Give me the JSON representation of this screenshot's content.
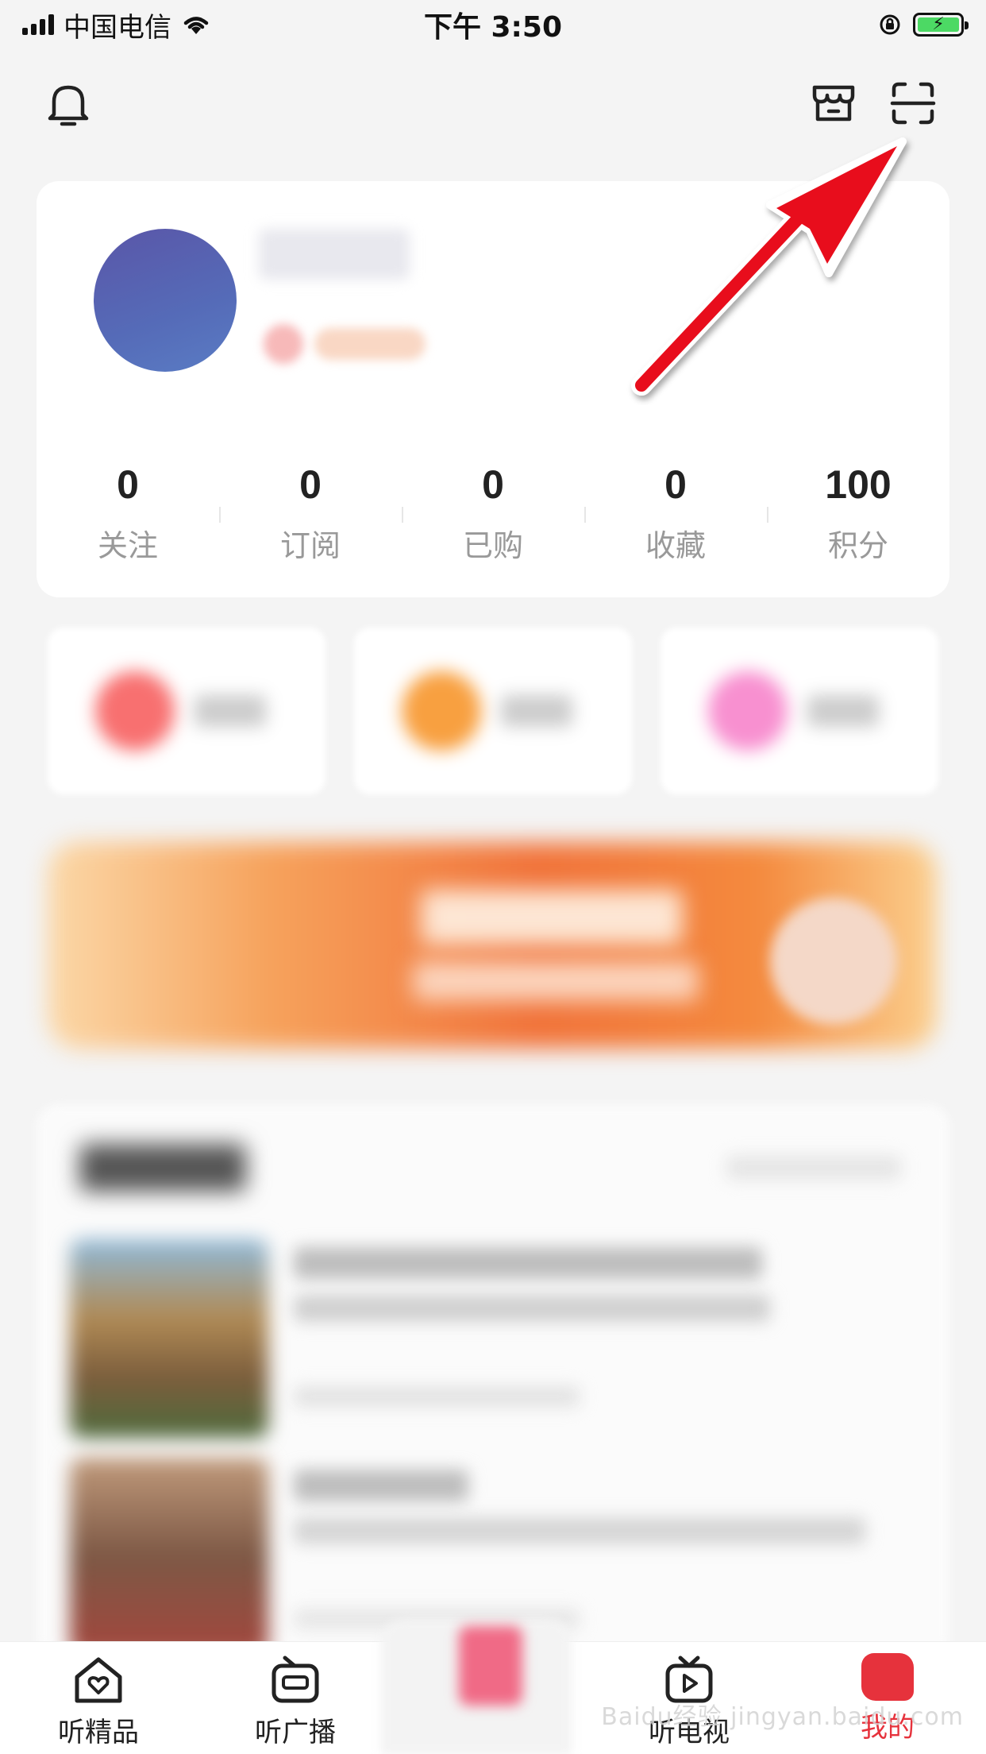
{
  "status_bar": {
    "carrier": "中国电信",
    "time": "下午 3:50",
    "battery_icon": "battery-charging-icon"
  },
  "header": {
    "left_icon": "bell-icon",
    "right_icons": [
      "store-icon",
      "scan-icon"
    ]
  },
  "profile": {
    "stats": [
      {
        "value": "0",
        "label": "关注"
      },
      {
        "value": "0",
        "label": "订阅"
      },
      {
        "value": "0",
        "label": "已购"
      },
      {
        "value": "0",
        "label": "收藏"
      },
      {
        "value": "100",
        "label": "积分"
      }
    ]
  },
  "quick_actions": {
    "colors": [
      "#f87070",
      "#f8a040",
      "#f890d0"
    ]
  },
  "annotation": {
    "arrow_color": "#e8101c"
  },
  "tab_bar": {
    "tabs": [
      {
        "label": "听精品",
        "icon": "home-heart-icon"
      },
      {
        "label": "听广播",
        "icon": "radio-icon"
      },
      {
        "label": "听电视",
        "icon": "tv-play-icon"
      },
      {
        "label": "我的",
        "icon": "profile-icon"
      }
    ],
    "active_color": "#e6323c"
  },
  "watermark": "Baidu经验 jingyan.baidu.com"
}
